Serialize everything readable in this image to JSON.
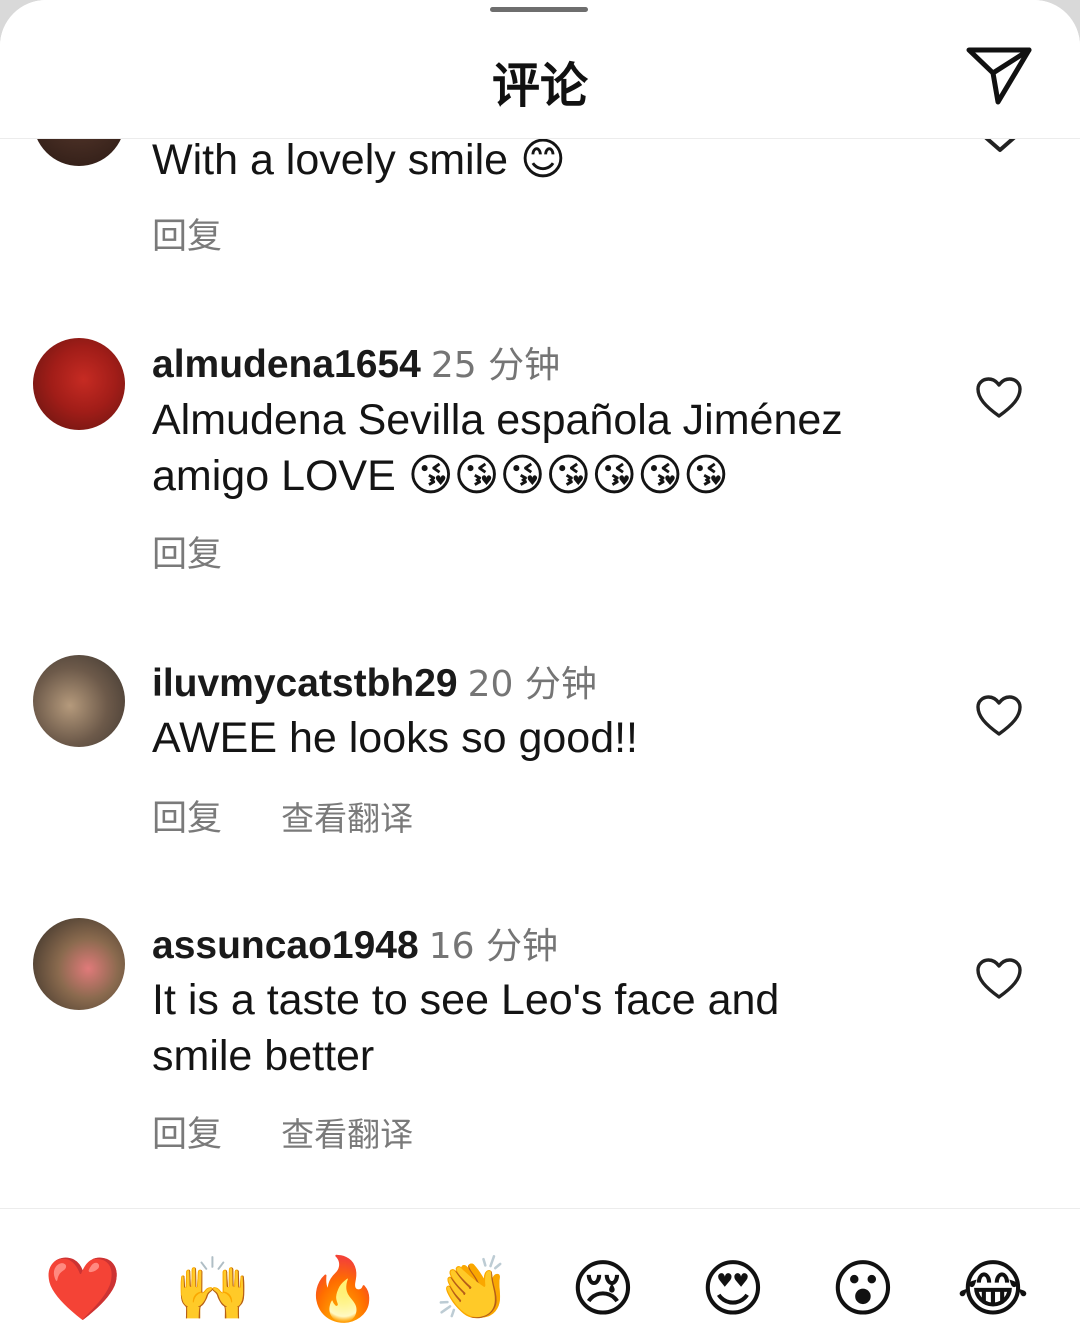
{
  "header": {
    "title": "评论",
    "share_icon": "paper-plane-icon"
  },
  "top_comment": {
    "text": "With a lovely smile",
    "emoji": "😊",
    "reply_label": "回复"
  },
  "comments": [
    {
      "username": "almudena1654",
      "time": "25 分钟",
      "text_line1": "Almudena Sevilla española Jiménez",
      "text_line2": "amigo LOVE",
      "emojis": "😘😘😘😘😘😘😘",
      "reply_label": "回复"
    },
    {
      "username": "iluvmycatstbh29",
      "time": "20 分钟",
      "text": "AWEE he looks so good!!",
      "reply_label": "回复",
      "translate_label": "查看翻译"
    },
    {
      "username": "assuncao1948",
      "time": "16 分钟",
      "text": "It is a taste to see Leo's face and smile better",
      "reply_label": "回复",
      "translate_label": "查看翻译"
    }
  ],
  "reactions": [
    "❤️",
    "🙌",
    "🔥",
    "👏",
    "😢",
    "😍",
    "😮",
    "😂"
  ],
  "colors": {
    "muted": "#7a7a7a",
    "heart_red": "#e0245e"
  }
}
